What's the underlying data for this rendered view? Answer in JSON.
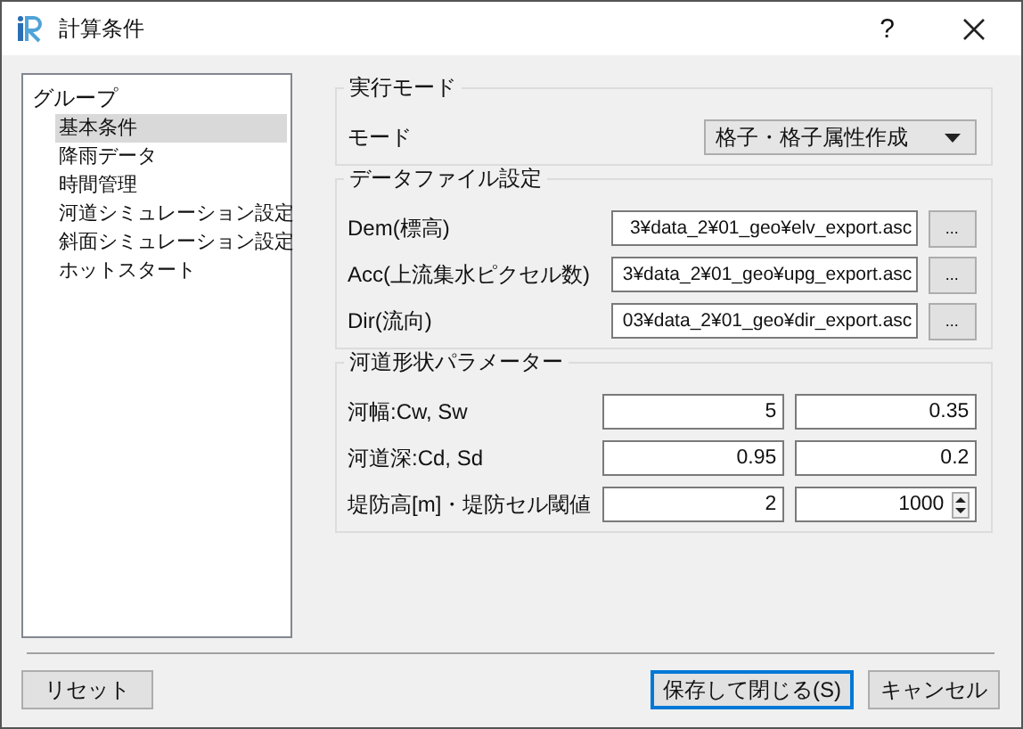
{
  "window": {
    "title": "計算条件",
    "help": "?"
  },
  "sidebar": {
    "title": "グループ",
    "items": [
      {
        "label": "基本条件",
        "selected": true
      },
      {
        "label": "降雨データ",
        "selected": false
      },
      {
        "label": "時間管理",
        "selected": false
      },
      {
        "label": "河道シミュレーション設定",
        "selected": false
      },
      {
        "label": "斜面シミュレーション設定",
        "selected": false
      },
      {
        "label": "ホットスタート",
        "selected": false
      }
    ]
  },
  "groups": [
    {
      "title": "実行モード",
      "rows": [
        {
          "kind": "combo",
          "label": "モード",
          "value": "格子・格子属性作成"
        }
      ]
    },
    {
      "title": "データファイル設定",
      "rows": [
        {
          "kind": "file",
          "label": "Dem(標高)",
          "value": "3¥data_2¥01_geo¥elv_export.asc",
          "button": "..."
        },
        {
          "kind": "file",
          "label": "Acc(上流集水ピクセル数)",
          "value": "3¥data_2¥01_geo¥upg_export.asc",
          "button": "..."
        },
        {
          "kind": "file",
          "label": "Dir(流向)",
          "value": "03¥data_2¥01_geo¥dir_export.asc",
          "button": "..."
        }
      ]
    },
    {
      "title": "河道形状パラメーター",
      "rows": [
        {
          "kind": "pair",
          "label": "河幅:Cw, Sw",
          "values": [
            "5",
            "0.35"
          ],
          "spin": false
        },
        {
          "kind": "pair",
          "label": "河道深:Cd, Sd",
          "values": [
            "0.95",
            "0.2"
          ],
          "spin": false
        },
        {
          "kind": "pair",
          "label": "堤防高[m]・堤防セル閾値",
          "values": [
            "2",
            "1000"
          ],
          "spin": true
        }
      ]
    }
  ],
  "buttons": [
    {
      "label": "リセット",
      "default": false
    },
    {
      "label": "保存して閉じる(S)",
      "default": true
    },
    {
      "label": "キャンセル",
      "default": false
    }
  ]
}
